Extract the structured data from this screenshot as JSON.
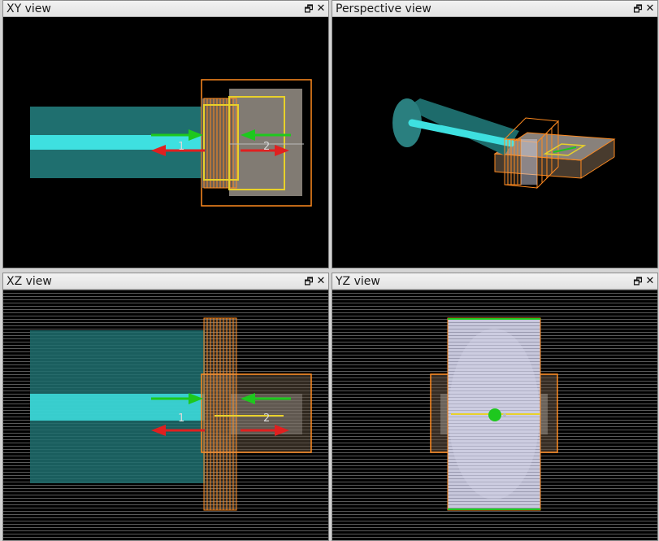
{
  "panes": {
    "xy": {
      "title": "XY view"
    },
    "perspective": {
      "title": "Perspective view"
    },
    "xz": {
      "title": "XZ view"
    },
    "yz": {
      "title": "YZ view"
    }
  },
  "controls": {
    "restore_glyph": "🗗",
    "close_glyph": "✕"
  },
  "port_labels": {
    "port1": "1",
    "port2": "2"
  },
  "colors": {
    "background": "#000000",
    "cable": "#1f6f6f",
    "conductor": "#3ee0e0",
    "wireframe": "#ff8a1f",
    "incident_arrow": "#1ec81e",
    "reflected_arrow": "#e02020",
    "port_outline": "#e8d12a",
    "grid_line": "#5a5a5a"
  }
}
